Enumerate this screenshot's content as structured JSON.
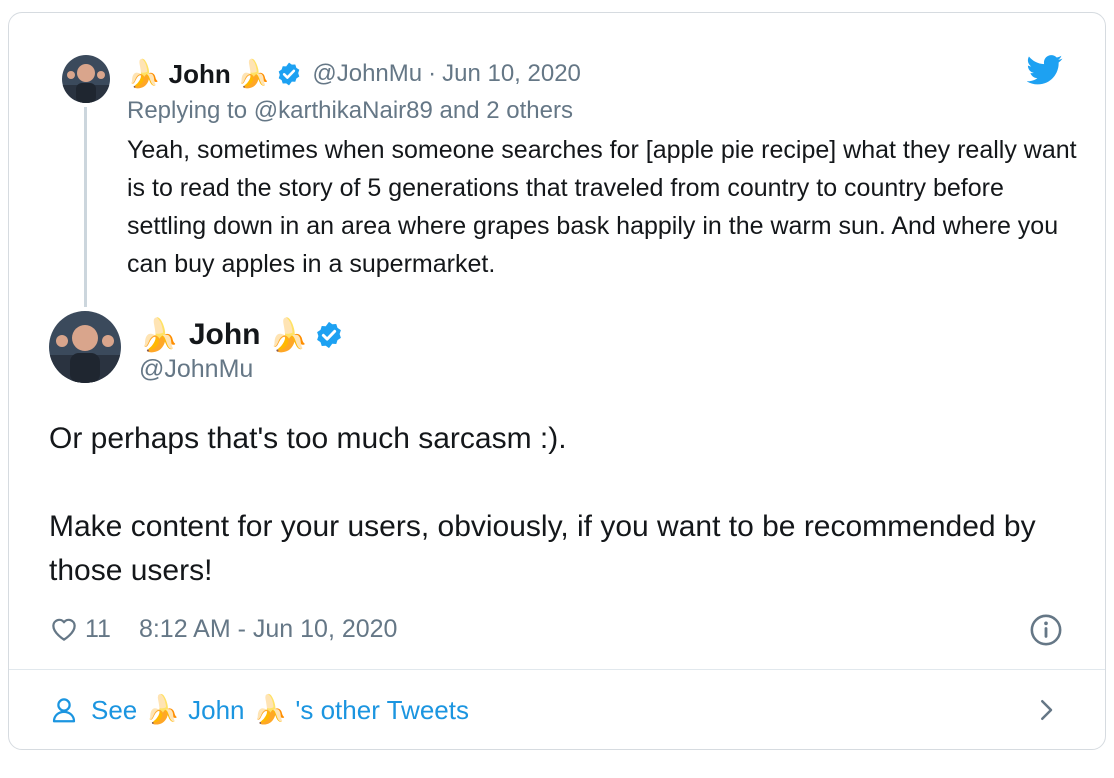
{
  "parent_tweet": {
    "name": "John",
    "name_emoji": "🍌",
    "handle": "@JohnMu",
    "separator": "·",
    "date": "Jun 10, 2020",
    "replying_prefix": "Replying to ",
    "replying_user": "@karthikaNair89",
    "replying_suffix": " and 2 others",
    "text": "Yeah, sometimes when someone searches for [apple pie recipe] what they really want is to read the story of 5 generations that traveled from country to country before settling down in an area where grapes bask happily in the warm sun. And where you can buy apples in a supermarket."
  },
  "main_tweet": {
    "name": "John",
    "name_emoji": "🍌",
    "handle": "@JohnMu",
    "text_line_1": "Or perhaps that's too much sarcasm :).",
    "text_line_2": "Make content for your users, obviously, if you want to be recommended by those users!",
    "like_count": "11",
    "timestamp": "8:12 AM - Jun 10, 2020"
  },
  "footer": {
    "prefix": "See",
    "name": "John",
    "emoji": "🍌",
    "suffix": "'s other Tweets"
  },
  "icons": {
    "brand": "twitter-bird-icon",
    "verified": "verified-badge-icon",
    "like": "heart-icon",
    "info": "info-icon",
    "profile": "person-icon",
    "more": "chevron-right-icon"
  },
  "colors": {
    "brand_blue": "#1da1f2",
    "link_blue": "#1b95e0",
    "text": "#14171a",
    "muted": "#657786",
    "border": "#d6dbe0"
  }
}
